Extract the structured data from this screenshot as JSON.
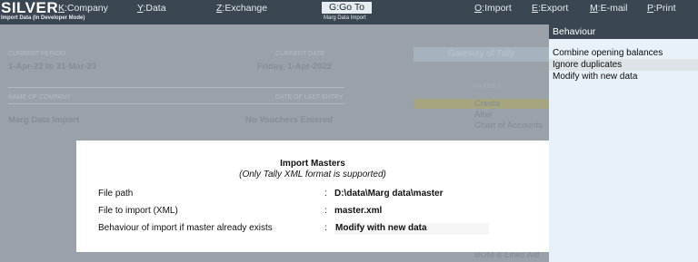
{
  "topbar": {
    "brand": "SILVER",
    "mode": "Import Data (In Developer Mode)",
    "menu": [
      {
        "key": "K",
        "label": ":Company"
      },
      {
        "key": "Y",
        "label": ":Data"
      },
      {
        "key": "Z",
        "label": ":Exchange"
      },
      {
        "key": "O",
        "label": ":Import"
      },
      {
        "key": "E",
        "label": ":Export"
      },
      {
        "key": "M",
        "label": ":E-mail"
      },
      {
        "key": "P",
        "label": ":Print"
      }
    ],
    "goto": {
      "key": "G",
      "label": ":Go To",
      "subtitle": "Marg Data Import"
    }
  },
  "background": {
    "current_period_label": "CURRENT PERIOD",
    "current_period": "1-Apr-22 to 31-Mar-23",
    "current_date_label": "CURRENT DATE",
    "current_date": "Friday, 1-Apr-2022",
    "name_of_company_label": "NAME OF COMPANY",
    "date_of_last_entry_label": "DATE OF LAST ENTRY",
    "company_name": "Marg Data Import",
    "last_entry": "No Vouchers Entered",
    "gateway_title": "Gateway of Tally",
    "gateway_section": "MASTERS",
    "gateway_items": [
      "Create",
      "Alter",
      "Chart of Accounts"
    ],
    "gateway_bottom": "BOM & Links Aid"
  },
  "behaviour_panel": {
    "title": "Behaviour",
    "options": [
      "Combine opening balances",
      "Ignore duplicates",
      "Modify with new data"
    ],
    "selected_index": 1
  },
  "dialog": {
    "title": "Import Masters",
    "subtitle": "(Only Tally XML format is supported)",
    "fields": [
      {
        "label": "File path",
        "value": "D:\\data\\Marg data\\master"
      },
      {
        "label": "File to import (XML)",
        "value": "master.xml"
      },
      {
        "label": "Behaviour of import if master already exists",
        "value": "Modify with new data"
      }
    ],
    "colon": ":"
  }
}
